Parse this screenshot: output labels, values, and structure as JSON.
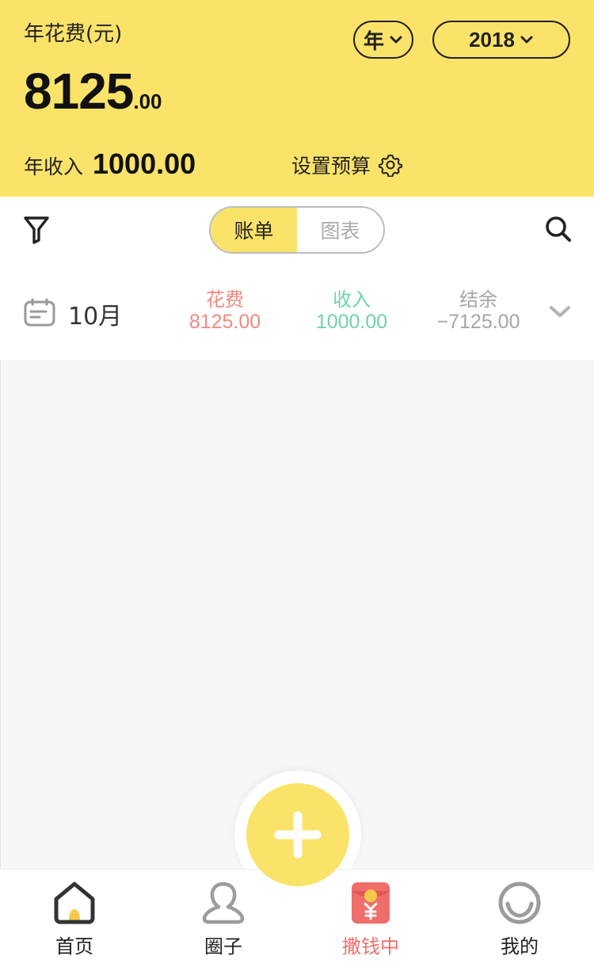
{
  "header": {
    "title": "年花费(元)",
    "total_int": "8125",
    "total_dec": ".00",
    "period_unit": "年",
    "period_value": "2018",
    "income_label": "年收入",
    "income_value": "1000.00",
    "budget_label": "设置预算"
  },
  "toolbar": {
    "tabs": [
      {
        "label": "账单",
        "active": true
      },
      {
        "label": "图表",
        "active": false
      }
    ]
  },
  "month_summary": {
    "month": "10月",
    "spend_label": "花费",
    "spend_value": "8125.00",
    "income_label": "收入",
    "income_value": "1000.00",
    "balance_label": "结余",
    "balance_value": "−7125.00"
  },
  "tabbar": {
    "items": [
      {
        "label": "首页",
        "icon": "home-icon"
      },
      {
        "label": "圈子",
        "icon": "person-icon"
      },
      {
        "label": "撒钱中",
        "icon": "red-envelope-icon"
      },
      {
        "label": "我的",
        "icon": "smile-icon"
      }
    ]
  },
  "colors": {
    "brand_yellow": "#fbe36a",
    "spend_red": "#ef8a82",
    "income_green": "#6fd3a9",
    "balance_gray": "#a6a6a6",
    "envelope_red": "#ef6e6a"
  }
}
